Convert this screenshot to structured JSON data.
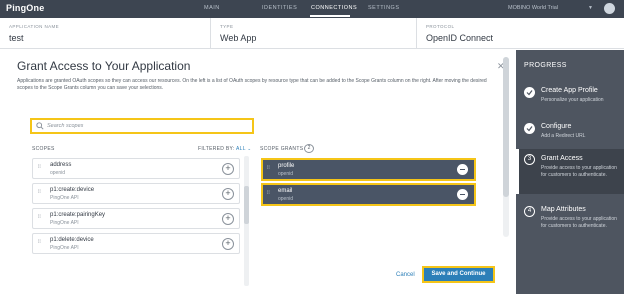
{
  "nav": {
    "logo": "PingOne",
    "items": [
      "MAIN",
      "IDENTITIES",
      "CONNECTIONS",
      "SETTINGS"
    ],
    "active_item": "CONNECTIONS",
    "user": "MOBINO World Trial"
  },
  "info": {
    "app_name_label": "APPLICATION NAME",
    "app_name": "test",
    "type_label": "TYPE",
    "type": "Web App",
    "protocol_label": "PROTOCOL",
    "protocol": "OpenID Connect"
  },
  "main": {
    "title": "Grant Access to Your Application",
    "description": "Applications are granted OAuth scopes so they can access our resources. On the left is a list of OAuth scopes by resource type that can be added to the Scope Grants column on the right. After moving the desired scopes to the Scope Grants column you can save your selections.",
    "search_placeholder": "Search scopes",
    "scopes_header": "SCOPES",
    "filter_label": "FILTERED BY:",
    "filter_value": "ALL",
    "scope_grants_header": "SCOPE GRANTS",
    "grant_count": "2",
    "scopes": [
      {
        "name": "address",
        "resource": "openid"
      },
      {
        "name": "p1:create:device",
        "resource": "PingOne API"
      },
      {
        "name": "p1:create:pairingKey",
        "resource": "PingOne API"
      },
      {
        "name": "p1:delete:device",
        "resource": "PingOne API"
      }
    ],
    "grants": [
      {
        "name": "profile",
        "resource": "openid"
      },
      {
        "name": "email",
        "resource": "openid"
      }
    ],
    "cancel_label": "Cancel",
    "save_label": "Save and Continue"
  },
  "progress": {
    "title": "PROGRESS",
    "steps": [
      {
        "name": "Create App Profile",
        "desc": "Personalize your application",
        "state": "done"
      },
      {
        "name": "Configure",
        "desc": "Add a Redirect URL",
        "state": "done"
      },
      {
        "num": "3",
        "name": "Grant Access",
        "desc": "Provide access to your application for customers to authenticate.",
        "state": "active"
      },
      {
        "num": "4",
        "name": "Map Attributes",
        "desc": "Provide access to your application for customers to authenticate.",
        "state": "pending"
      }
    ]
  },
  "colors": {
    "nav_bg": "#3d4551",
    "sidebar_bg": "#4e5560",
    "grant_bg": "#4a5566",
    "accent": "#2c7fb8",
    "highlight": "#f5c518"
  }
}
